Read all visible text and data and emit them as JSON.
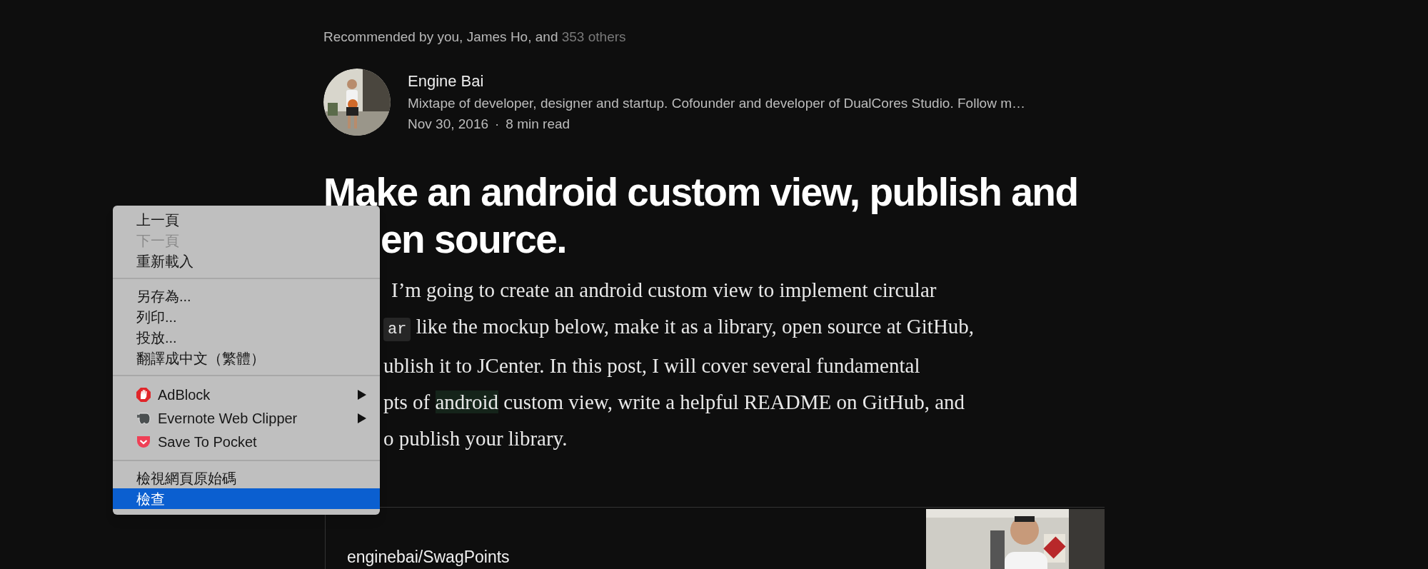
{
  "recommended": [
    {
      "text": "Recommended by you, James Ho, and ",
      "kind": "plain"
    },
    {
      "text": "353 others",
      "kind": "link"
    }
  ],
  "author": {
    "name": "Engine Bai",
    "bio": "Mixtape of developer, designer and startup. Cofounder and developer of DualCores Studio. Follow m…",
    "date": "Nov 30, 2016",
    "separator": "·",
    "read_time": "8 min read"
  },
  "title_lines": [
    "Make an android custom view, publish and",
    "en source."
  ],
  "body_lines": [
    [
      {
        "text": "I’m going to create an android custom view to implement circular",
        "kind": "plain"
      }
    ],
    [
      {
        "text": "ar",
        "kind": "code"
      },
      {
        "text": " like the mockup below, make it as a library, open source at GitHub,",
        "kind": "plain"
      }
    ],
    [
      {
        "text": "ublish it to JCenter. In this post, I will cover several fundamental",
        "kind": "plain"
      }
    ],
    [
      {
        "text": "pts of ",
        "kind": "plain"
      },
      {
        "text": "android",
        "kind": "mark"
      },
      {
        "text": " custom view, write a helpful README on GitHub, and",
        "kind": "plain"
      }
    ],
    [
      {
        "text": "o publish your library.",
        "kind": "plain"
      }
    ]
  ],
  "embed_card": {
    "title": "enginebai/SwagPoints"
  },
  "context_menu": {
    "groups": [
      {
        "kind": "plain",
        "items": [
          {
            "label": "上一頁",
            "disabled": false,
            "selected": false
          },
          {
            "label": "下一頁",
            "disabled": true,
            "selected": false
          },
          {
            "label": "重新載入",
            "disabled": false,
            "selected": false
          }
        ]
      },
      {
        "kind": "plain",
        "items": [
          {
            "label": "另存為...",
            "disabled": false,
            "selected": false
          },
          {
            "label": "列印...",
            "disabled": false,
            "selected": false
          },
          {
            "label": "投放...",
            "disabled": false,
            "selected": false
          },
          {
            "label": "翻譯成中文（繁體）",
            "disabled": false,
            "selected": false
          }
        ]
      },
      {
        "kind": "extensions",
        "items": [
          {
            "label": "AdBlock",
            "submenu": true,
            "disabled": false,
            "selected": false
          },
          {
            "label": "Evernote Web Clipper",
            "submenu": true,
            "disabled": false,
            "selected": false
          },
          {
            "label": "Save To Pocket",
            "submenu": false,
            "disabled": false,
            "selected": false
          }
        ]
      },
      {
        "kind": "plain",
        "items": [
          {
            "label": "檢視網頁原始碼",
            "disabled": false,
            "selected": false
          },
          {
            "label": "檢查",
            "disabled": false,
            "selected": true
          }
        ]
      }
    ]
  }
}
